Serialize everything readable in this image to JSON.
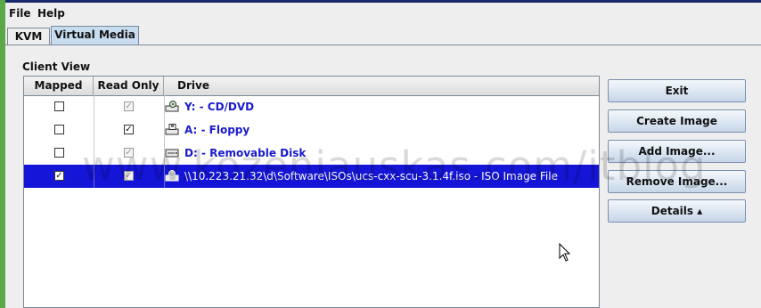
{
  "menubar": {
    "file": "File",
    "help": "Help"
  },
  "tabs": {
    "kvm": "KVM",
    "virtual_media": "Virtual Media",
    "active": "Virtual Media"
  },
  "client_view": {
    "label": "Client View",
    "columns": {
      "mapped": "Mapped",
      "read_only": "Read Only",
      "drive": "Drive"
    },
    "rows": [
      {
        "mapped": false,
        "read_only": true,
        "read_only_enabled": false,
        "icon": "cd-dvd-drive-icon",
        "drive": "Y: - CD/DVD",
        "selected": false
      },
      {
        "mapped": false,
        "read_only": true,
        "read_only_enabled": true,
        "icon": "floppy-drive-icon",
        "drive": "A: - Floppy",
        "selected": false
      },
      {
        "mapped": false,
        "read_only": true,
        "read_only_enabled": false,
        "icon": "removable-disk-icon",
        "drive": "D: - Removable Disk",
        "selected": false
      },
      {
        "mapped": true,
        "read_only": true,
        "read_only_enabled": false,
        "icon": "iso-image-icon",
        "drive": "\\\\10.223.21.32\\d\\Software\\ISOs\\ucs-cxx-scu-3.1.4f.iso - ISO Image File",
        "selected": true
      }
    ]
  },
  "buttons": {
    "exit": "Exit",
    "create_image": "Create Image",
    "add_image": "Add Image...",
    "remove_image": "Remove Image...",
    "details": "Details ▴"
  },
  "watermark": "www.kozeniauskas.com/itblog",
  "colors": {
    "selection": "#1515d8",
    "drive_text": "#1a1acc",
    "tab_active": "#c8dcf0"
  }
}
